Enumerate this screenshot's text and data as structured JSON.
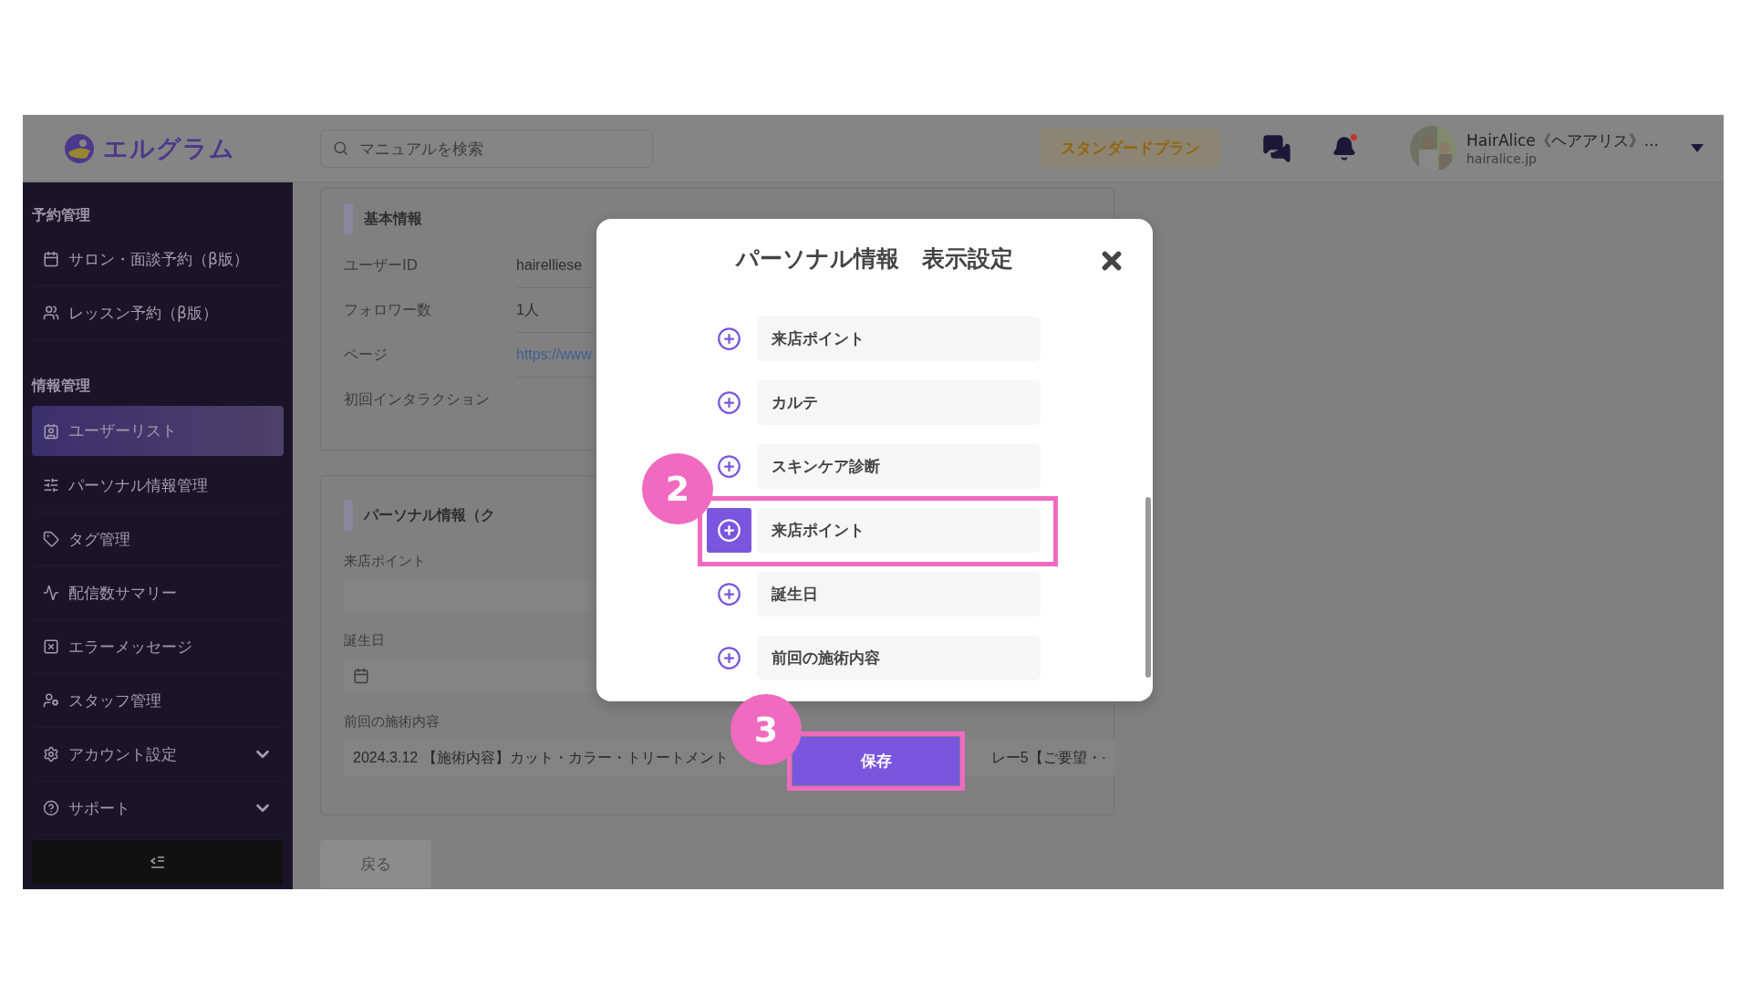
{
  "header": {
    "logo": "エルグラム",
    "search": {
      "placeholder": "マニュアルを検索"
    },
    "plan_badge": "スタンダードプラン",
    "notification_unread": true,
    "account": {
      "name": "HairAlice《ヘアアリス》...",
      "domain": "hairalice.jp"
    }
  },
  "sidebar": {
    "sections": [
      {
        "title": "予約管理",
        "items": [
          {
            "label": "サロン・面談予約（β版）",
            "kind": "link",
            "selected": false
          },
          {
            "label": "レッスン予約（β版）",
            "kind": "link",
            "selected": false
          }
        ]
      },
      {
        "title": "情報管理",
        "items": [
          {
            "label": "ユーザーリスト",
            "kind": "link",
            "selected": true
          },
          {
            "label": "パーソナル情報管理",
            "kind": "link",
            "selected": false
          },
          {
            "label": "タグ管理",
            "kind": "link",
            "selected": false
          },
          {
            "label": "配信数サマリー",
            "kind": "link",
            "selected": false
          },
          {
            "label": "エラーメッセージ",
            "kind": "link",
            "selected": false
          },
          {
            "label": "スタッフ管理",
            "kind": "link",
            "selected": false
          },
          {
            "label": "アカウント設定",
            "kind": "menu",
            "selected": false
          },
          {
            "label": "サポート",
            "kind": "menu",
            "selected": false
          }
        ]
      }
    ]
  },
  "basic_info": {
    "title": "基本情報",
    "rows": [
      {
        "label": "ユーザーID",
        "value": "hairelliese",
        "kind": "text"
      },
      {
        "label": "フォロワー数",
        "value": "1人",
        "kind": "text"
      },
      {
        "label": "ページ",
        "value": "https://www",
        "kind": "link"
      },
      {
        "label": "初回インタラクション"
      }
    ]
  },
  "personal_info": {
    "title": "パーソナル情報（ク",
    "fields": [
      {
        "label": "来店ポイント",
        "kind": "text"
      },
      {
        "label": "誕生日",
        "kind": "date"
      },
      {
        "label": "前回の施術内容",
        "kind": "text",
        "value_start": "2024.3.12 【施術内容】カット・カラー・トリートメント",
        "value_end": "レー5【ご要望・·"
      }
    ]
  },
  "back_button": "戻る",
  "modal": {
    "title": "パーソナル情報　表示設定",
    "step_marker": "2",
    "items": [
      {
        "label": "来店ポイント",
        "highlighted": false
      },
      {
        "label": "カルテ",
        "highlighted": false
      },
      {
        "label": "スキンケア診断",
        "highlighted": false
      },
      {
        "label": "来店ポイント",
        "highlighted": true
      },
      {
        "label": "誕生日",
        "highlighted": false
      },
      {
        "label": "前回の施術内容",
        "highlighted": false
      }
    ]
  },
  "save_button": {
    "label": "保存",
    "step_marker": "3"
  }
}
